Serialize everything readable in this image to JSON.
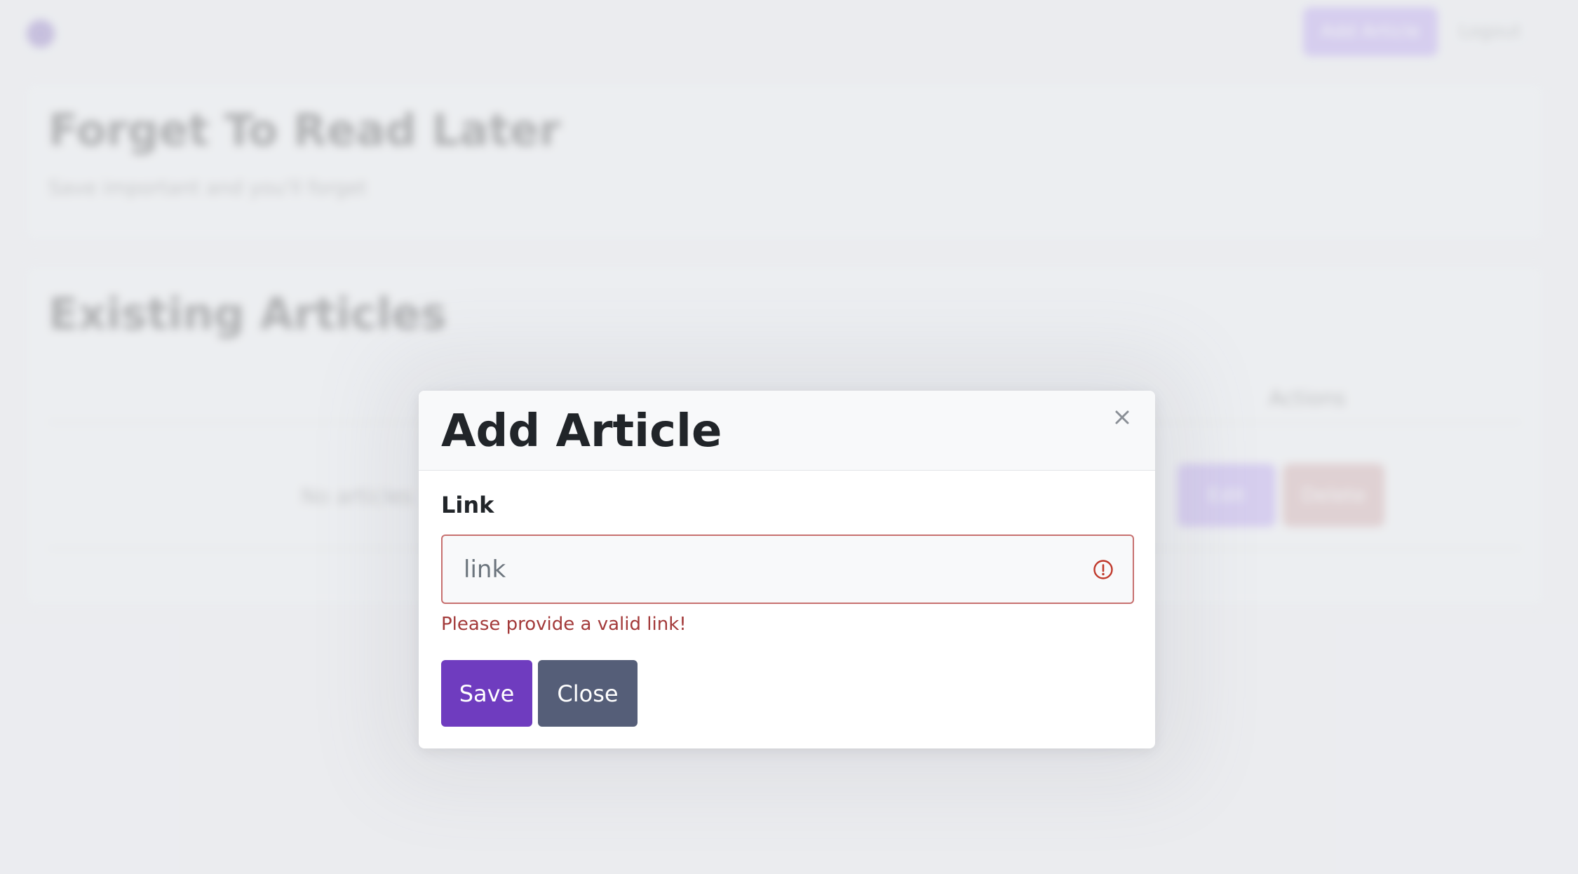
{
  "background": {
    "nav_button_label": "Add Article",
    "nav_link_label": "Logout",
    "hero_title": "Forget To Read Later",
    "hero_subtitle": "Save important and you'll forget",
    "section_title": "Existing Articles",
    "table_actions_header": "Actions",
    "row_text": "No articles",
    "row_edit_label": "Edit",
    "row_delete_label": "Delete"
  },
  "modal": {
    "title": "Add Article",
    "close_icon": "close-icon",
    "field": {
      "label": "Link",
      "value": "",
      "placeholder": "link",
      "error_icon": "exclamation-circle-icon",
      "error_text": "Please provide a valid link!"
    },
    "buttons": {
      "save_label": "Save",
      "close_label": "Close"
    }
  },
  "colors": {
    "primary": "#6f3cbf",
    "secondary": "#555e78",
    "danger": "#c7706f",
    "danger_text": "#a33a3a"
  }
}
